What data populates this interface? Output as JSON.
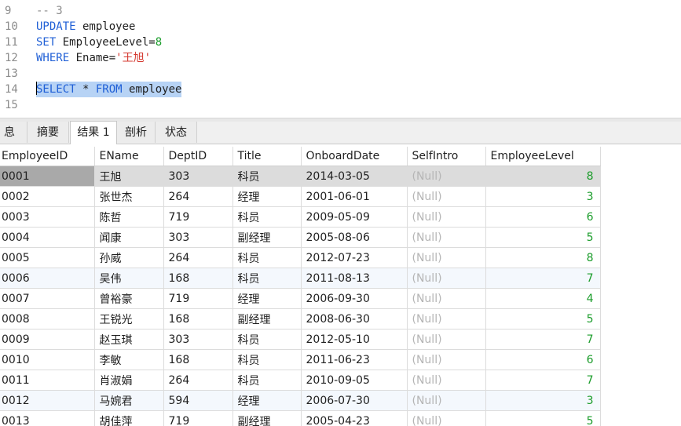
{
  "editor": {
    "lines": [
      {
        "no": "9"
      },
      {
        "no": "10"
      },
      {
        "no": "11"
      },
      {
        "no": "12"
      },
      {
        "no": "13"
      },
      {
        "no": "14"
      },
      {
        "no": "15"
      }
    ],
    "line9_comment": "-- 3",
    "line10_kw": "UPDATE",
    "line10_rest": " employee",
    "line11_kw": "SET",
    "line11_mid": " EmployeeLevel=",
    "line11_num": "8",
    "line12_kw": "WHERE",
    "line12_mid": " Ename=",
    "line12_str": "'王旭'",
    "line14_kw1": "SELECT",
    "line14_mid": " * ",
    "line14_kw2": "FROM",
    "line14_rest": " employee"
  },
  "tabs": [
    "息",
    "摘要",
    "结果 1",
    "剖析",
    "状态"
  ],
  "active_tab": "结果 1",
  "grid": {
    "columns": [
      "EmployeeID",
      "EName",
      "DeptID",
      "Title",
      "OnboardDate",
      "SelfIntro",
      "EmployeeLevel"
    ],
    "rows": [
      [
        "0001",
        "王旭",
        "303",
        "科员",
        "2014-03-05",
        "(Null)",
        "8"
      ],
      [
        "0002",
        "张世杰",
        "264",
        "经理",
        "2001-06-01",
        "(Null)",
        "3"
      ],
      [
        "0003",
        "陈哲",
        "719",
        "科员",
        "2009-05-09",
        "(Null)",
        "6"
      ],
      [
        "0004",
        "闻康",
        "303",
        "副经理",
        "2005-08-06",
        "(Null)",
        "5"
      ],
      [
        "0005",
        "孙威",
        "264",
        "科员",
        "2012-07-23",
        "(Null)",
        "8"
      ],
      [
        "0006",
        "吴伟",
        "168",
        "科员",
        "2011-08-13",
        "(Null)",
        "7"
      ],
      [
        "0007",
        "曾裕豪",
        "719",
        "经理",
        "2006-09-30",
        "(Null)",
        "4"
      ],
      [
        "0008",
        "王锐光",
        "168",
        "副经理",
        "2008-06-30",
        "(Null)",
        "5"
      ],
      [
        "0009",
        "赵玉琪",
        "303",
        "科员",
        "2012-05-10",
        "(Null)",
        "7"
      ],
      [
        "0010",
        "李敏",
        "168",
        "科员",
        "2011-06-23",
        "(Null)",
        "6"
      ],
      [
        "0011",
        "肖淑娟",
        "264",
        "科员",
        "2010-09-05",
        "(Null)",
        "7"
      ],
      [
        "0012",
        "马婉君",
        "594",
        "经理",
        "2006-07-30",
        "(Null)",
        "3"
      ],
      [
        "0013",
        "胡佳萍",
        "719",
        "副经理",
        "2005-04-23",
        "(Null)",
        "5"
      ]
    ]
  },
  "colors": {
    "keyword": "#1f5fd6",
    "number": "#1a9c2a",
    "string": "#d4372e",
    "selection": "#b7d3f5",
    "null_text": "#b5b5b5"
  }
}
